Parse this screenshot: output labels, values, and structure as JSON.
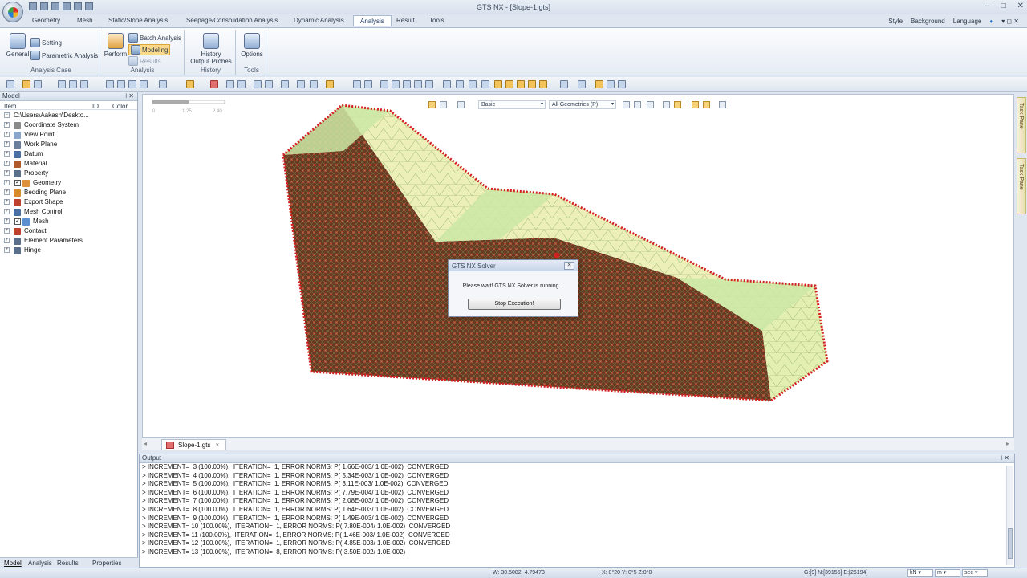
{
  "window": {
    "title": "GTS NX - [Slope-1.gts]"
  },
  "menu_tabs": [
    "Geometry",
    "Mesh",
    "Static/Slope Analysis",
    "Seepage/Consolidation Analysis",
    "Dynamic Analysis",
    "Analysis",
    "Result",
    "Tools"
  ],
  "active_tab": "Analysis",
  "menu_right": {
    "style": "Style",
    "background": "Background",
    "language": "Language"
  },
  "ribbon": {
    "analysis_case": {
      "label": "Analysis Case",
      "general": "General",
      "setting": "Setting",
      "parametric": "Parametric Analysis"
    },
    "analysis": {
      "label": "Analysis",
      "perform": "Perform",
      "batch": "Batch Analysis",
      "modeling": "Modeling",
      "results": "Results"
    },
    "history": {
      "label": "History",
      "output_probes": "History\nOutput Probes"
    },
    "tools": {
      "label": "Tools",
      "options": "Options"
    }
  },
  "model_panel": {
    "title": "Model",
    "columns": {
      "item": "Item",
      "id": "ID",
      "color": "Color"
    },
    "root": "C:\\Users\\Aakash\\Deskto...",
    "nodes": [
      {
        "label": "Coordinate System",
        "icon": "axes-icon",
        "checked": false,
        "color": "#8a8a8a"
      },
      {
        "label": "View Point",
        "icon": "camera-icon",
        "checked": false,
        "color": "#8aa7c9"
      },
      {
        "label": "Work Plane",
        "icon": "grid-icon",
        "checked": false,
        "color": "#6a7e9c"
      },
      {
        "label": "Datum",
        "icon": "datum-icon",
        "checked": false,
        "color": "#4a6fa5"
      },
      {
        "label": "Material",
        "icon": "material-icon",
        "checked": false,
        "color": "#b05a2a"
      },
      {
        "label": "Property",
        "icon": "property-icon",
        "checked": false,
        "color": "#5b6e8a"
      },
      {
        "label": "Geometry",
        "icon": "cube-icon",
        "checked": true,
        "color": "#e0923a"
      },
      {
        "label": "Bedding Plane",
        "icon": "plane-icon",
        "checked": false,
        "color": "#d98a2c"
      },
      {
        "label": "Export Shape",
        "icon": "export-icon",
        "checked": false,
        "color": "#c04030"
      },
      {
        "label": "Mesh Control",
        "icon": "mesh-control-icon",
        "checked": false,
        "color": "#4a6fa5"
      },
      {
        "label": "Mesh",
        "icon": "mesh-icon",
        "checked": true,
        "color": "#5b8fd0"
      },
      {
        "label": "Contact",
        "icon": "contact-icon",
        "checked": false,
        "color": "#c04030"
      },
      {
        "label": "Element Parameters",
        "icon": "parameters-icon",
        "checked": false,
        "color": "#5b6e8a"
      },
      {
        "label": "Hinge",
        "icon": "hinge-icon",
        "checked": false,
        "color": "#5b6e8a"
      }
    ],
    "bottom_tabs": [
      "Model",
      "Analysis",
      "Results",
      "Properties"
    ]
  },
  "viewport": {
    "scale_ticks": [
      "0",
      "1.25",
      "2.40"
    ],
    "display_mode": "Basic",
    "filter": "All Geometries (P)"
  },
  "dialog": {
    "title": "GTS NX Solver",
    "message": "Please wait! GTS NX Solver is running...",
    "button": "Stop Execution!"
  },
  "document_tab": "Slope-1.gts",
  "output": {
    "title": "Output",
    "lines": [
      "> INCREMENT=  3 (100.00%),  ITERATION=  1, ERROR NORMS: P( 1.66E-003/ 1.0E-002)  CONVERGED",
      "> INCREMENT=  4 (100.00%),  ITERATION=  1, ERROR NORMS: P( 5.34E-003/ 1.0E-002)  CONVERGED",
      "> INCREMENT=  5 (100.00%),  ITERATION=  1, ERROR NORMS: P( 3.11E-003/ 1.0E-002)  CONVERGED",
      "> INCREMENT=  6 (100.00%),  ITERATION=  1, ERROR NORMS: P( 7.79E-004/ 1.0E-002)  CONVERGED",
      "> INCREMENT=  7 (100.00%),  ITERATION=  1, ERROR NORMS: P( 2.08E-003/ 1.0E-002)  CONVERGED",
      "> INCREMENT=  8 (100.00%),  ITERATION=  1, ERROR NORMS: P( 1.64E-003/ 1.0E-002)  CONVERGED",
      "> INCREMENT=  9 (100.00%),  ITERATION=  1, ERROR NORMS: P( 1.49E-003/ 1.0E-002)  CONVERGED",
      "> INCREMENT= 10 (100.00%),  ITERATION=  1, ERROR NORMS: P( 7.80E-004/ 1.0E-002)  CONVERGED",
      "> INCREMENT= 11 (100.00%),  ITERATION=  1, ERROR NORMS: P( 1.46E-003/ 1.0E-002)  CONVERGED",
      "> INCREMENT= 12 (100.00%),  ITERATION=  1, ERROR NORMS: P( 4.85E-003/ 1.0E-002)  CONVERGED",
      "> INCREMENT= 13 (100.00%),  ITERATION=  8, ERROR NORMS: P( 3.50E-002/ 1.0E-002)"
    ]
  },
  "status": {
    "w": "W: 30.5082, 4.79473",
    "angles": "X: 0°20 Y: 0°5 Z:0°0",
    "counts": "G:[9] N:[39155] E:[26194]",
    "force_unit": "kN",
    "length_unit": "m",
    "time_unit": "sec"
  },
  "task_pane": [
    "Task Pane",
    "Task Pane"
  ],
  "colors": {
    "ribbon_bg": "#e6ecf4",
    "mesh_green": "#d9edb0",
    "soil_brown": "#6b3a22",
    "node_red": "#d42020"
  }
}
